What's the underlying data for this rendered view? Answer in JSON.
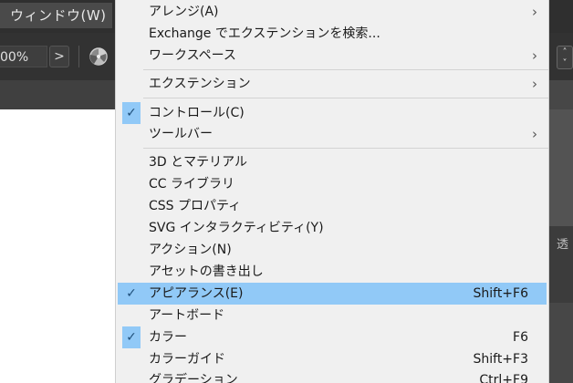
{
  "menubar": {
    "window_menu_label": "ウィンドウ(W)"
  },
  "toolbar": {
    "zoom_value": "00%",
    "zoom_arrow": ">"
  },
  "right_panel": {
    "tab_label": "透"
  },
  "menu": {
    "items": [
      {
        "label": "アレンジ(A)",
        "submenu": true,
        "checked": false,
        "shortcut": ""
      },
      {
        "label": "Exchange でエクステンションを検索...",
        "submenu": false,
        "checked": false,
        "shortcut": ""
      },
      {
        "label": "ワークスペース",
        "submenu": true,
        "checked": false,
        "shortcut": ""
      },
      {
        "label": "エクステンション",
        "submenu": true,
        "checked": false,
        "shortcut": ""
      },
      {
        "label": "コントロール(C)",
        "submenu": false,
        "checked": true,
        "shortcut": ""
      },
      {
        "label": "ツールバー",
        "submenu": true,
        "checked": false,
        "shortcut": ""
      },
      {
        "label": "3D とマテリアル",
        "submenu": false,
        "checked": false,
        "shortcut": ""
      },
      {
        "label": "CC ライブラリ",
        "submenu": false,
        "checked": false,
        "shortcut": ""
      },
      {
        "label": "CSS プロパティ",
        "submenu": false,
        "checked": false,
        "shortcut": ""
      },
      {
        "label": "SVG インタラクティビティ(Y)",
        "submenu": false,
        "checked": false,
        "shortcut": ""
      },
      {
        "label": "アクション(N)",
        "submenu": false,
        "checked": false,
        "shortcut": ""
      },
      {
        "label": "アセットの書き出し",
        "submenu": false,
        "checked": false,
        "shortcut": ""
      },
      {
        "label": "アピアランス(E)",
        "submenu": false,
        "checked": true,
        "highlighted": true,
        "shortcut": "Shift+F6"
      },
      {
        "label": "アートボード",
        "submenu": false,
        "checked": false,
        "shortcut": ""
      },
      {
        "label": "カラー",
        "submenu": false,
        "checked": true,
        "shortcut": "F6"
      },
      {
        "label": "カラーガイド",
        "submenu": false,
        "checked": false,
        "shortcut": "Shift+F3"
      },
      {
        "label": "グラデーション",
        "submenu": false,
        "checked": false,
        "shortcut": "Ctrl+F9"
      }
    ],
    "check_glyph": "✓",
    "submenu_glyph": "›"
  },
  "colors": {
    "menu_bg": "#f0f0f0",
    "highlight": "#91c9f7",
    "app_bg": "#323232"
  }
}
